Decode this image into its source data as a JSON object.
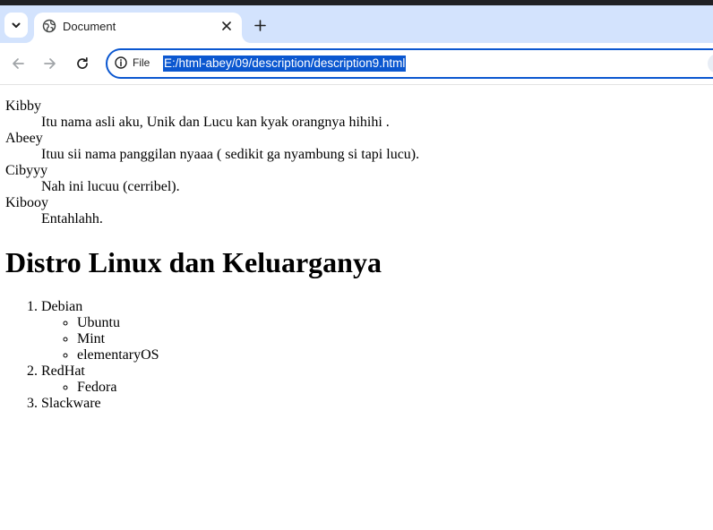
{
  "browser": {
    "tab_title": "Document",
    "site_info_label": "File",
    "url": "E:/html-abey/09/description/description9.html",
    "icons": {
      "tab_menu": "chevron-down-icon",
      "favicon": "globe-icon",
      "tab_close": "close-icon",
      "new_tab": "plus-icon",
      "back": "arrow-left-icon",
      "forward": "arrow-right-icon",
      "reload": "reload-icon",
      "site_info": "info-icon"
    },
    "colors": {
      "tab_bar": "#d3e3fd",
      "omnibox_border": "#0b57d0",
      "url_selection": "#0b57d0"
    }
  },
  "page": {
    "descriptions": [
      {
        "term": "Kibby",
        "desc": "Itu nama asli aku, Unik dan Lucu kan kyak orangnya hihihi ."
      },
      {
        "term": "Abeey",
        "desc": "Ituu sii nama panggilan nyaaa ( sedikit ga nyambung si tapi lucu)."
      },
      {
        "term": "Cibyyy",
        "desc": "Nah ini lucuu (cerribel)."
      },
      {
        "term": "Kibooy",
        "desc": "Entahlahh."
      }
    ],
    "heading": "Distro Linux dan Keluarganya",
    "distros": [
      {
        "name": "Debian",
        "children": [
          "Ubuntu",
          "Mint",
          "elementaryOS"
        ]
      },
      {
        "name": "RedHat",
        "children": [
          "Fedora"
        ]
      },
      {
        "name": "Slackware",
        "children": []
      }
    ]
  }
}
